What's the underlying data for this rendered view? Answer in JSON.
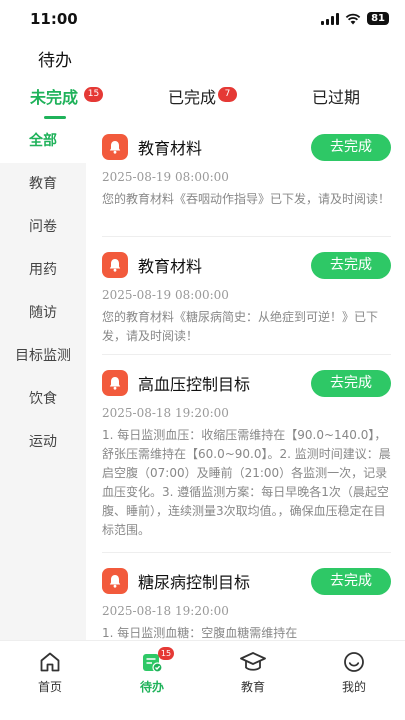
{
  "status_bar": {
    "time": "11:00",
    "battery": "81"
  },
  "page": {
    "title": "待办"
  },
  "tabs": [
    {
      "label": "未完成",
      "badge": "15"
    },
    {
      "label": "已完成",
      "badge": "7"
    },
    {
      "label": "已过期"
    }
  ],
  "sidebar": {
    "items": [
      {
        "label": "全部"
      },
      {
        "label": "教育"
      },
      {
        "label": "问卷"
      },
      {
        "label": "用药"
      },
      {
        "label": "随访"
      },
      {
        "label": "目标监测"
      },
      {
        "label": "饮食"
      },
      {
        "label": "运动"
      }
    ]
  },
  "cards": [
    {
      "title": "教育材料",
      "button": "去完成",
      "date": "2025-08-19 08:00:00",
      "desc": "您的教育材料《吞咽动作指导》已下发，请及时阅读！"
    },
    {
      "title": "教育材料",
      "button": "去完成",
      "date": "2025-08-19 08:00:00",
      "desc": "您的教育材料《糖尿病简史：从绝症到可逆！》已下发，请及时阅读！"
    },
    {
      "title": "高血压控制目标",
      "button": "去完成",
      "date": "2025-08-18 19:20:00",
      "desc": "1. 每日监测血压：收缩压需维持在【90.0~140.0】，舒张压需维持在【60.0~90.0】。2. 监测时间建议：晨启空腹（07:00）及睡前（21:00）各监测一次，记录血压变化。3. 遵循监测方案：每日早晚各1次（晨起空腹、睡前），连续测量3次取均值。，确保血压稳定在目标范围。"
    },
    {
      "title": "糖尿病控制目标",
      "button": "去完成",
      "date": "2025-08-18 19:20:00",
      "desc": "1. 每日监测血糖：空腹血糖需维持在"
    }
  ],
  "bottom_nav": {
    "items": [
      {
        "label": "首页",
        "icon": "home-icon"
      },
      {
        "label": "待办",
        "icon": "todo-icon",
        "badge": "15"
      },
      {
        "label": "教育",
        "icon": "education-icon"
      },
      {
        "label": "我的",
        "icon": "profile-icon"
      }
    ]
  },
  "colors": {
    "accent": "#1fb25a",
    "button": "#2ec866",
    "badge": "#e53935",
    "bell": "#f25a3c"
  }
}
